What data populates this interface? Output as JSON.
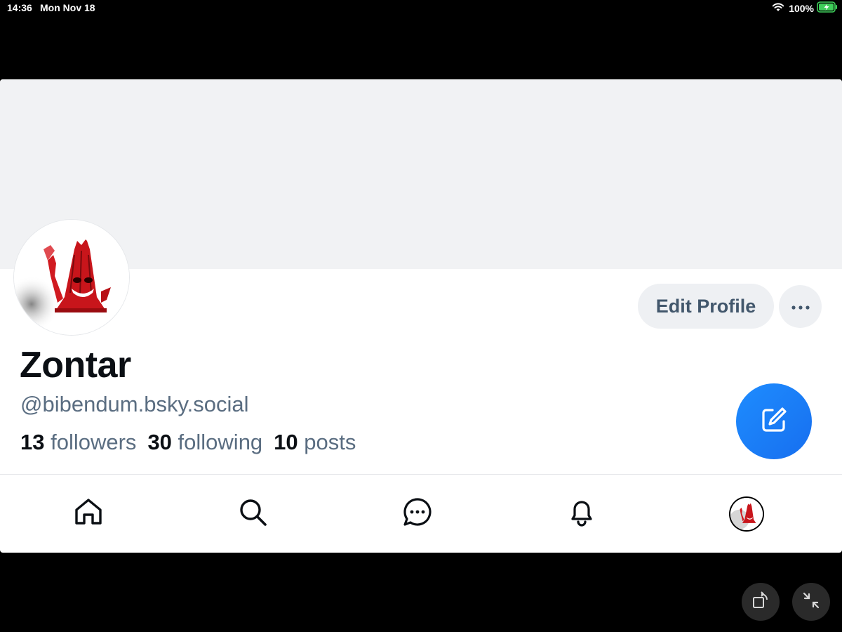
{
  "status_bar": {
    "time": "14:36",
    "date": "Mon Nov 18",
    "battery": "100%",
    "icons": [
      "wifi-icon",
      "battery-charging-icon"
    ]
  },
  "profile": {
    "display_name": "Zontar",
    "handle": "@bibendum.bsky.social",
    "followers_count": "13",
    "followers_label": "followers",
    "following_count": "30",
    "following_label": "following",
    "posts_count": "10",
    "posts_label": "posts",
    "edit_button_label": "Edit Profile",
    "more_icon": "ellipsis-icon"
  },
  "compose_fab": {
    "icon": "compose-icon",
    "color": "#1a7bf5"
  },
  "tab_bar": {
    "items": [
      "home-icon",
      "search-icon",
      "chat-icon",
      "bell-icon",
      "profile-avatar"
    ]
  },
  "window_controls": [
    "rotate-icon",
    "minimize-icon"
  ],
  "colors": {
    "accent": "#1a7bf5",
    "banner": "#f1f2f4",
    "secondary_text": "#5a6d81",
    "button_bg": "#eef0f3"
  }
}
